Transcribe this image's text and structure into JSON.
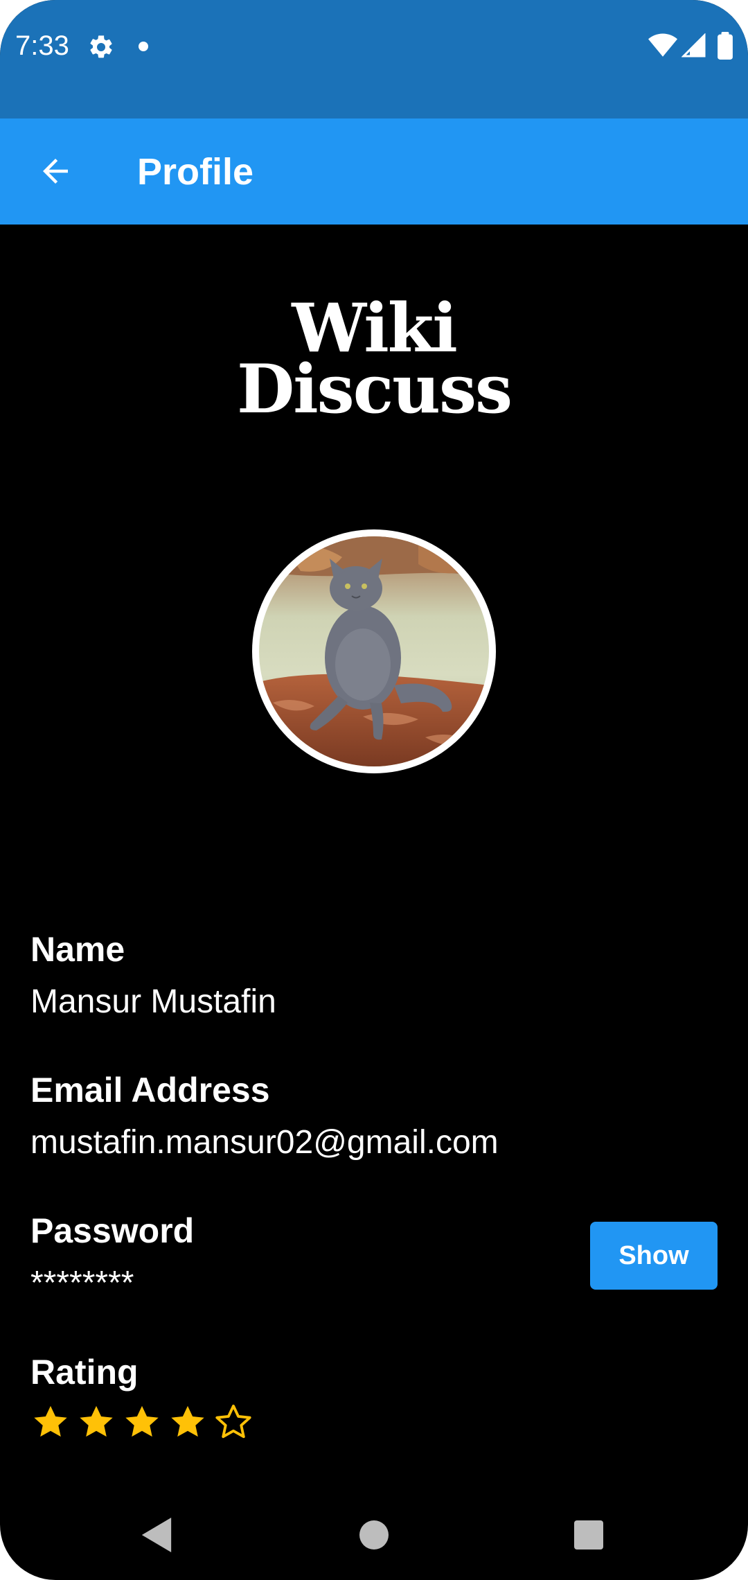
{
  "status_bar": {
    "time": "7:33",
    "icons": [
      "gear-icon",
      "dot-icon",
      "wifi-icon",
      "signal-icon",
      "battery-icon"
    ]
  },
  "app_bar": {
    "title": "Profile",
    "back_icon": "arrow-left-icon",
    "color": "#2196f3"
  },
  "logo": {
    "line1": "Wiki",
    "line2": "Discuss"
  },
  "avatar": {
    "description_icon": "avatar-cat-photo"
  },
  "profile": {
    "name_label": "Name",
    "name_value": "Mansur Mustafin",
    "email_label": "Email Address",
    "email_value": "mustafin.mansur02@gmail.com",
    "password_label": "Password",
    "password_value": "********",
    "show_button_label": "Show",
    "rating_label": "Rating",
    "rating_value": 4,
    "rating_max": 5
  },
  "colors": {
    "status_bar": "#1b72b8",
    "accent": "#2196f3",
    "star": "#ffc107",
    "background": "#000000"
  },
  "nav_bar": {
    "icons": [
      "nav-back-icon",
      "nav-home-icon",
      "nav-recents-icon"
    ]
  }
}
